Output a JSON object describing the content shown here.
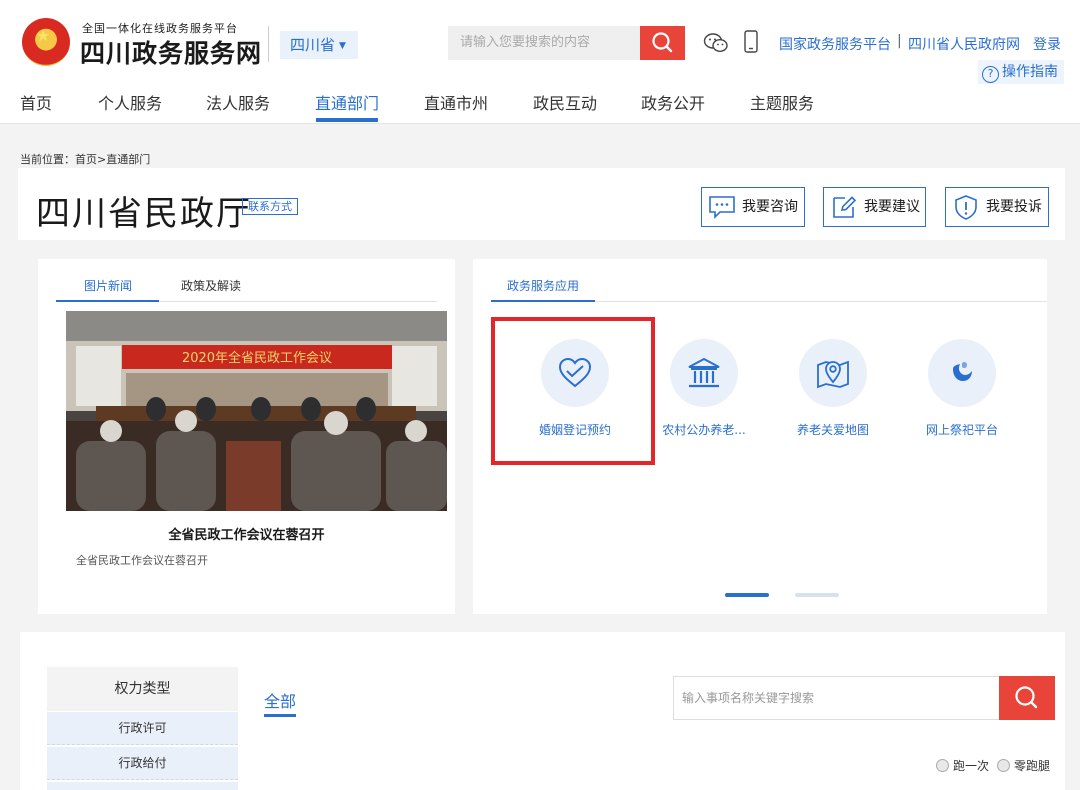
{
  "header": {
    "site_subtitle": "全国一体化在线政务服务平台",
    "site_title": "四川政务服务网",
    "region": "四川省",
    "search_placeholder": "请输入您要搜索的内容",
    "links": [
      "国家政务服务平台",
      "四川省人民政府网"
    ],
    "login": "登录",
    "guide": "操作指南",
    "accent_color": "#2a6fd0",
    "search_button_color": "#e8443a"
  },
  "nav": {
    "items": [
      "首页",
      "个人服务",
      "法人服务",
      "直通部门",
      "直通市州",
      "政民互动",
      "政务公开",
      "主题服务"
    ],
    "active": "直通部门"
  },
  "breadcrumb": "当前位置：首页>直通部门",
  "department": {
    "title": "四川省民政厅",
    "contact": "联系方式",
    "actions": [
      "我要咨询",
      "我要建议",
      "我要投诉"
    ]
  },
  "news_panel": {
    "tabs": [
      "图片新闻",
      "政策及解读"
    ],
    "active_tab": "图片新闻",
    "banner_text": "2020年全省民政工作会议",
    "caption": "全省民政工作会议在蓉召开",
    "summary": "全省民政工作会议在蓉召开"
  },
  "apps_panel": {
    "tab": "政务服务应用",
    "apps": [
      {
        "label": "婚姻登记预约",
        "icon": "heart-icon"
      },
      {
        "label": "农村公办养老...",
        "icon": "institution-icon"
      },
      {
        "label": "养老关爱地图",
        "icon": "map-pin-icon"
      },
      {
        "label": "网上祭祀平台",
        "icon": "memorial-icon"
      }
    ],
    "highlighted_app": "婚姻登记预约",
    "highlight_color": "#e2262a",
    "pagination": {
      "pages": 2,
      "current": 1
    }
  },
  "bottom": {
    "sidebar_header": "权力类型",
    "sidebar_items": [
      "行政许可",
      "行政给付"
    ],
    "tab": "全部",
    "search_placeholder": "输入事项名称关键字搜索",
    "filters": [
      "跑一次",
      "零跑腿"
    ]
  }
}
